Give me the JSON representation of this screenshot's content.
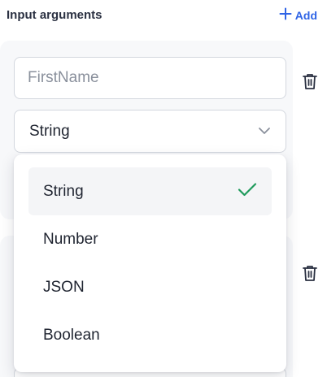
{
  "header": {
    "title": "Input arguments",
    "add_label": "Add"
  },
  "arguments": [
    {
      "name_placeholder": "FirstName",
      "name_value": "",
      "type_value": "String"
    }
  ],
  "type_options": [
    {
      "label": "String",
      "selected": true
    },
    {
      "label": "Number",
      "selected": false
    },
    {
      "label": "JSON",
      "selected": false
    },
    {
      "label": "Boolean",
      "selected": false
    }
  ],
  "icons": {
    "add": "plus-icon",
    "delete": "trash-icon",
    "expand": "chevron-down-icon",
    "selected": "check-icon"
  },
  "colors": {
    "accent": "#2f64e6",
    "check": "#1e9a5b",
    "card_background": "#f7f8fa",
    "border": "#d3d7de"
  }
}
